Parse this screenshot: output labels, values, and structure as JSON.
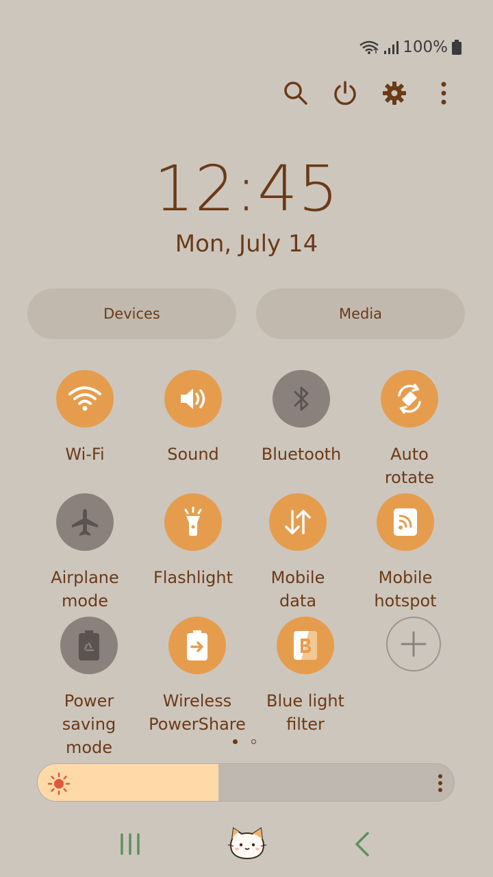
{
  "status_bar": {
    "battery_text": "100%",
    "icons": [
      "wifi-icon",
      "signal-icon",
      "battery-icon"
    ]
  },
  "top_actions": [
    "search-icon",
    "power-icon",
    "settings-icon",
    "more-vert-icon"
  ],
  "clock": {
    "time": "12:45",
    "date": "Mon, July 14"
  },
  "pills": {
    "devices": "Devices",
    "media": "Media"
  },
  "tiles": [
    {
      "label": "Wi-Fi",
      "state": "on",
      "icon": "wifi-icon"
    },
    {
      "label": "Sound",
      "state": "on",
      "icon": "volume-icon"
    },
    {
      "label": "Bluetooth",
      "state": "off",
      "icon": "bluetooth-icon"
    },
    {
      "label": "Auto\nrotate",
      "state": "on",
      "icon": "auto-rotate-icon"
    },
    {
      "label": "Airplane\nmode",
      "state": "off",
      "icon": "airplane-icon"
    },
    {
      "label": "Flashlight",
      "state": "on",
      "icon": "flashlight-icon"
    },
    {
      "label": "Mobile\ndata",
      "state": "on",
      "icon": "mobile-data-icon"
    },
    {
      "label": "Mobile\nhotspot",
      "state": "on",
      "icon": "hotspot-icon"
    },
    {
      "label": "Power saving\nmode",
      "state": "off",
      "icon": "power-saving-icon"
    },
    {
      "label": "Wireless\nPowerShare",
      "state": "on",
      "icon": "wireless-powershare-icon"
    },
    {
      "label": "Blue light\nfilter",
      "state": "on",
      "icon": "blue-light-filter-icon"
    },
    {
      "label": "",
      "state": "add",
      "icon": "add-icon"
    }
  ],
  "pager": {
    "pages": 2,
    "current": 1
  },
  "brightness": {
    "level": 0.435
  },
  "colors": {
    "background": "#cdc6bd",
    "accent": "#e59d4d",
    "text": "#6b3a17",
    "off_tile": "#8a817d",
    "brightness_fill": "#ffd9a8"
  },
  "navbar": [
    "recent-apps-icon",
    "home-cat-icon",
    "back-icon"
  ]
}
